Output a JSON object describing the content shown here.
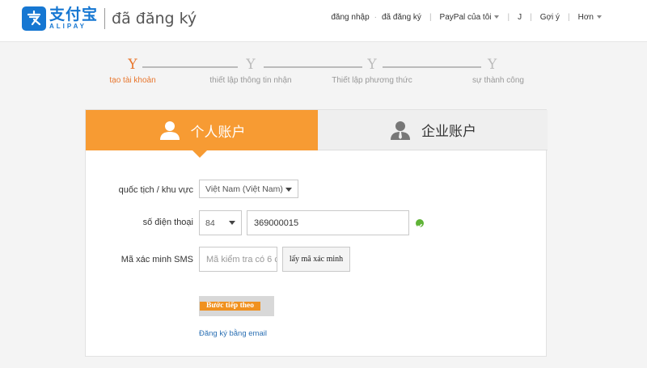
{
  "header": {
    "logo_cn": "支付宝",
    "logo_en": "ALIPAY",
    "title": "đã đăng ký",
    "nav": {
      "login": "đăng nhập",
      "registered": "đã đăng ký",
      "paypal": "PayPal của tôi",
      "j": "J",
      "suggest": "Gợi ý",
      "more": "Hơn"
    }
  },
  "steps": [
    {
      "glyph": "Y",
      "label": "tạo tài khoản",
      "active": true
    },
    {
      "glyph": "Y",
      "label": "thiết lập thông tin nhận",
      "active": false
    },
    {
      "glyph": "Y",
      "label": "Thiết lập phương thức",
      "active": false
    },
    {
      "glyph": "Y",
      "label": "sự thành công",
      "active": false
    }
  ],
  "tabs": {
    "personal": "个人账户",
    "business": "企业账户"
  },
  "form": {
    "nationality_label": "quốc tịch / khu vực",
    "nationality_value": "Việt Nam (Việt Nam)",
    "phone_label": "số điện thoại",
    "country_code": "84",
    "phone_value": "369000015",
    "sms_label": "Mã xác minh SMS",
    "sms_placeholder": "Mã kiểm tra có 6 c",
    "sms_button": "lấy mã xác minh",
    "next_button": "Bước tiếp theo",
    "email_link": "Đăng ký bằng email"
  },
  "colors": {
    "brand_blue": "#1677d2",
    "accent_orange": "#f79b33",
    "step_active": "#e8762d",
    "success_green": "#5fb336",
    "link_blue": "#2a6fb3"
  }
}
